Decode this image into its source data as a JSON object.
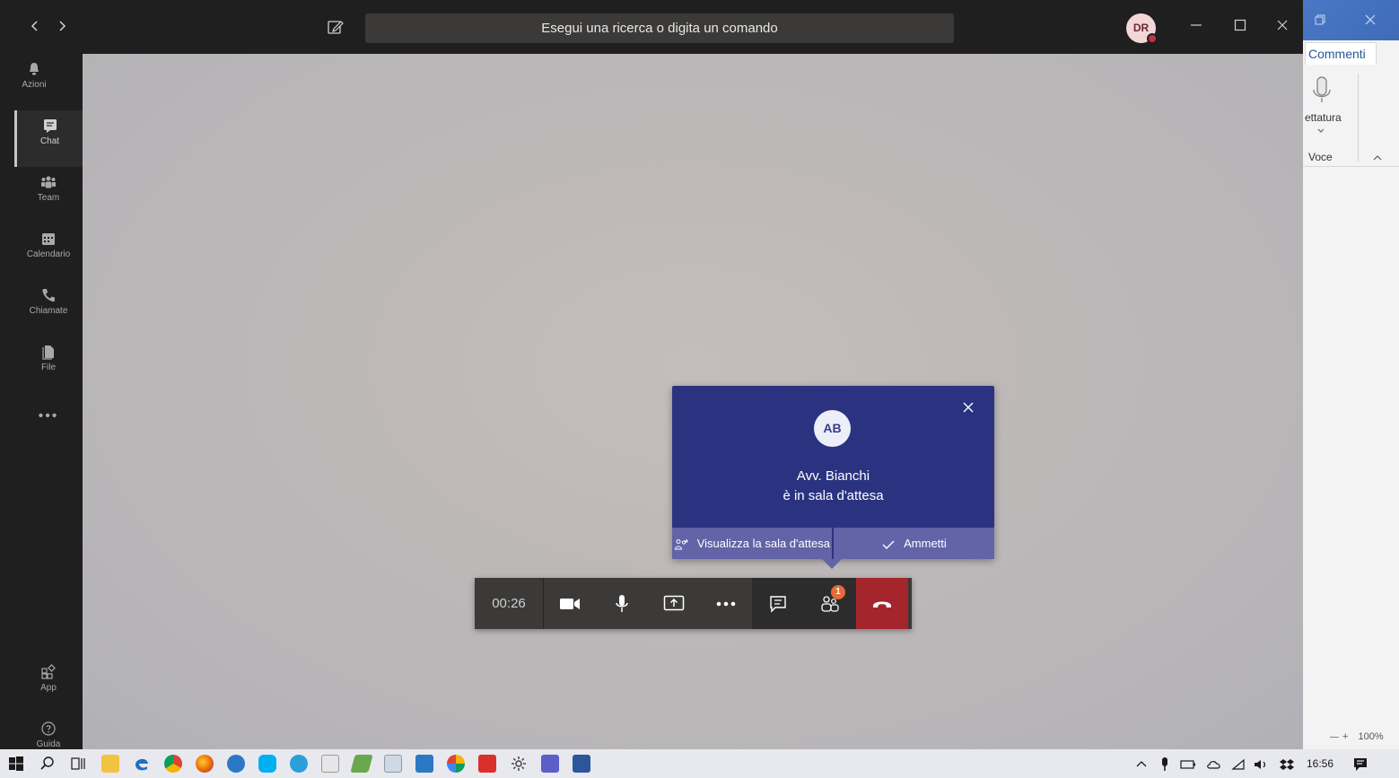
{
  "titlebar": {
    "back_icon": "chevron-left-icon",
    "forward_icon": "chevron-right-icon",
    "search_placeholder": "Esegui una ricerca o digita un comando",
    "avatar_initials": "DR"
  },
  "rail": {
    "items": [
      {
        "label": "Azioni",
        "icon": "bell-icon"
      },
      {
        "label": "Chat",
        "icon": "chat-icon"
      },
      {
        "label": "Team",
        "icon": "team-icon"
      },
      {
        "label": "Calendario",
        "icon": "calendar-icon"
      },
      {
        "label": "Chiamate",
        "icon": "phone-icon"
      },
      {
        "label": "File",
        "icon": "file-icon"
      }
    ],
    "more": "•••",
    "bottom": [
      {
        "label": "App",
        "icon": "apps-icon"
      },
      {
        "label": "Guida",
        "icon": "help-icon"
      }
    ]
  },
  "popup": {
    "avatar_initials": "AB",
    "name": "Avv. Bianchi",
    "status": "è in sala d'attesa",
    "view_lobby_label": "Visualizza la sala d'attesa",
    "admit_label": "Ammetti"
  },
  "controls": {
    "timer": "00:26",
    "participants_badge": "1"
  },
  "word": {
    "tab_label": "Commenti",
    "dictation_label": "ettatura",
    "group_label": "Voce",
    "zoom_label": "100%",
    "zoom_plus": "+"
  },
  "taskbar": {
    "time": "16:56"
  },
  "colors": {
    "popup_bg": "#2b3381",
    "popup_actions_bg": "#6264a7",
    "hangup": "#a4262c",
    "badge": "#e86a36"
  }
}
